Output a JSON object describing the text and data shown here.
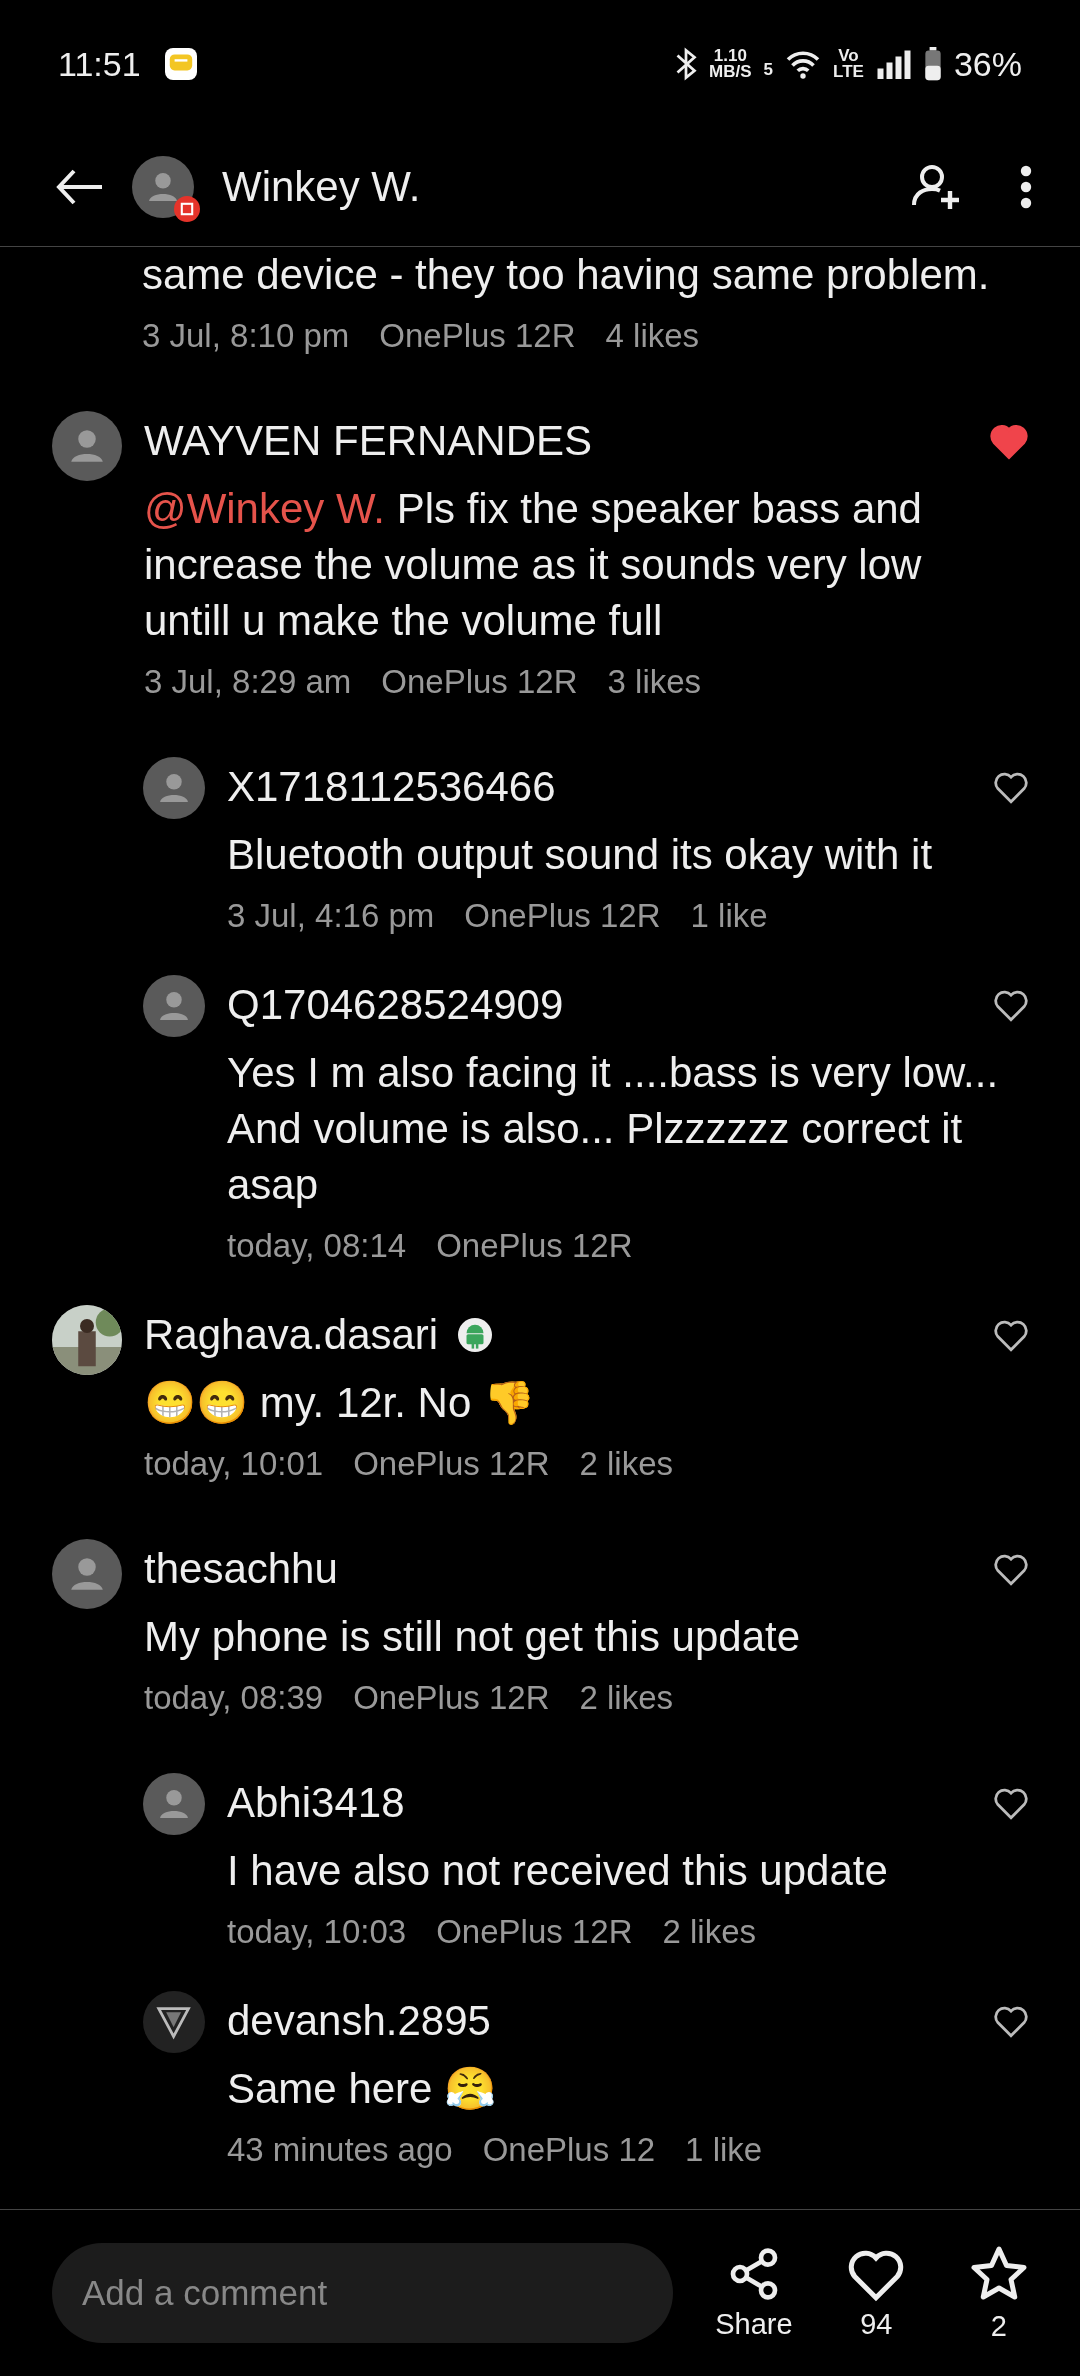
{
  "status_bar": {
    "time": "11:51",
    "speed": "1.10",
    "speed_unit": "MB/S",
    "network": "5",
    "volte": "Vo",
    "lte": "LTE",
    "battery": "36%"
  },
  "header": {
    "title": "Winkey W."
  },
  "comments": [
    {
      "kind": "tail",
      "text": "same device - they too having same problem.",
      "meta": [
        "3 Jul, 8:10 pm",
        "OnePlus 12R",
        "4 likes"
      ]
    },
    {
      "kind": "top",
      "avatar": {
        "kind": "default"
      },
      "author": "WAYVEN FERNANDES",
      "mention": "@Winkey W.",
      "text": "Pls fix the speaker bass and increase the volume as it sounds very low untill u make the volume full",
      "meta": [
        "3 Jul, 8:29 am",
        "OnePlus 12R",
        "3 likes"
      ],
      "liked": true
    },
    {
      "kind": "reply",
      "avatar": {
        "kind": "default"
      },
      "author": "X1718112536466",
      "text": "Bluetooth output sound its okay with it",
      "meta": [
        "3 Jul, 4:16 pm",
        "OnePlus 12R",
        "1 like"
      ],
      "liked": false
    },
    {
      "kind": "reply",
      "avatar": {
        "kind": "default"
      },
      "author": "Q1704628524909",
      "text": "Yes I m also facing it ....bass is very low... And volume is also... Plzzzzzz correct it asap",
      "meta": [
        "today, 08:14",
        "OnePlus 12R"
      ],
      "liked": false
    },
    {
      "kind": "top",
      "author": "Raghava.dasari",
      "badge": true,
      "text": "😁😁 my. 12r.  No 👎",
      "meta": [
        "today, 10:01",
        "OnePlus 12R",
        "2 likes"
      ],
      "liked": false
    },
    {
      "kind": "top",
      "avatar": {
        "kind": "default"
      },
      "author": "thesachhu",
      "text": "My phone is still not get this update",
      "meta": [
        "today, 08:39",
        "OnePlus 12R",
        "2 likes"
      ],
      "liked": false
    },
    {
      "kind": "reply",
      "avatar": {
        "kind": "default"
      },
      "author": "Abhi3418",
      "text": "I have also not received this update",
      "meta": [
        "today, 10:03",
        "OnePlus 12R",
        "2 likes"
      ],
      "liked": false
    },
    {
      "kind": "reply",
      "avatar": {
        "kind": "logo"
      },
      "author": "devansh.2895",
      "text": "Same here 😤",
      "meta": [
        "43 minutes ago",
        "OnePlus 12",
        "1 like"
      ],
      "liked": false
    }
  ],
  "bottom_bar": {
    "placeholder": "Add a comment",
    "share": "Share",
    "likes": "94",
    "favorites": "2"
  }
}
